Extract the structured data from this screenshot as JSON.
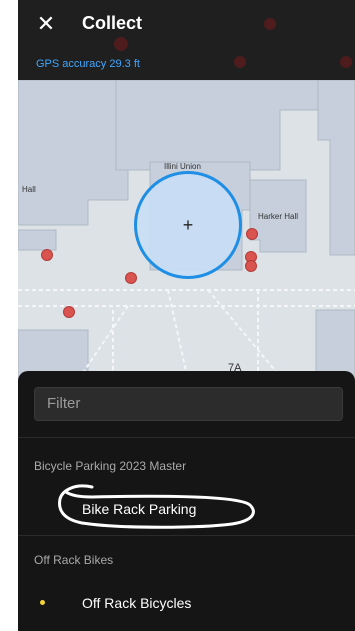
{
  "header": {
    "close_icon": "close-icon",
    "title": "Collect",
    "gps_accuracy": "GPS accuracy 29.3 ft"
  },
  "map": {
    "labels": {
      "illini_union": "Illini Union",
      "hall_left": "Hall",
      "harker_hall": "Harker Hall",
      "road_7a": "7A"
    },
    "accuracy_circle_color": "#1f8fe6",
    "marker_color": "#d9534f"
  },
  "sheet": {
    "filter_placeholder": "Filter",
    "groups": [
      {
        "title": "Bicycle Parking 2023 Master",
        "items": [
          {
            "label": "Bike Rack Parking"
          }
        ]
      },
      {
        "title": "Off Rack Bikes",
        "items": [
          {
            "label": "Off Rack Bicycles",
            "dot_color": "#f2d33a"
          }
        ]
      }
    ]
  }
}
